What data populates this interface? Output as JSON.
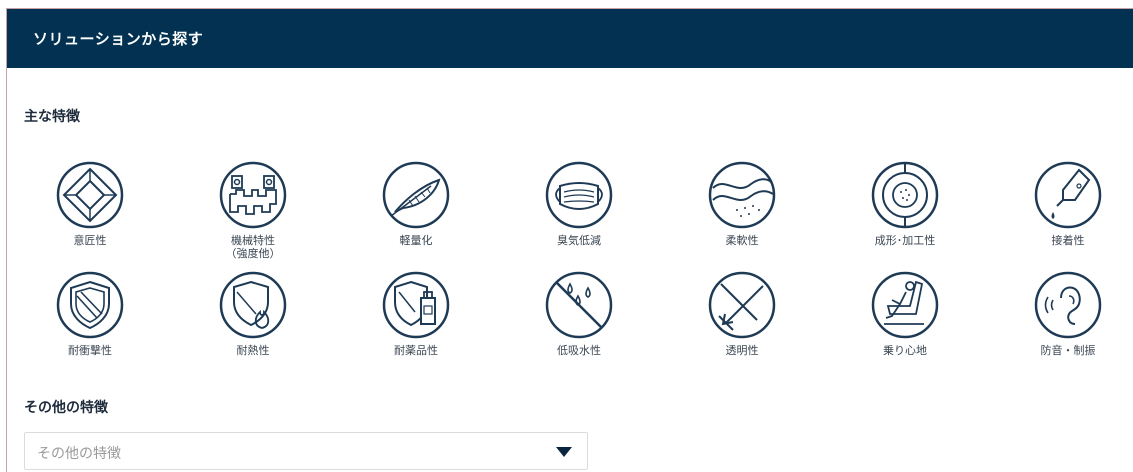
{
  "header": {
    "title": "ソリューションから探す"
  },
  "main_features": {
    "title": "主な特徴",
    "items": [
      {
        "label": "意匠性",
        "icon": "diamond-icon"
      },
      {
        "label": "機械特性\n（強度他）",
        "icon": "gears-icon"
      },
      {
        "label": "軽量化",
        "icon": "feather-icon"
      },
      {
        "label": "臭気低減",
        "icon": "mask-icon"
      },
      {
        "label": "柔軟性",
        "icon": "wave-icon"
      },
      {
        "label": "成形･加工性",
        "icon": "mold-icon"
      },
      {
        "label": "接着性",
        "icon": "glue-icon"
      },
      {
        "label": "耐衝撃性",
        "icon": "shield-icon"
      },
      {
        "label": "耐熱性",
        "icon": "heat-shield-icon"
      },
      {
        "label": "耐薬品性",
        "icon": "chemical-shield-icon"
      },
      {
        "label": "低吸水性",
        "icon": "water-drop-icon"
      },
      {
        "label": "透明性",
        "icon": "transparent-icon"
      },
      {
        "label": "乗り心地",
        "icon": "seat-icon"
      },
      {
        "label": "防音・制振",
        "icon": "ear-icon"
      }
    ]
  },
  "other_features": {
    "title": "その他の特徴",
    "select_placeholder": "その他の特徴"
  },
  "colors": {
    "header_bg": "#023152",
    "icon_stroke": "#1e3a55"
  }
}
